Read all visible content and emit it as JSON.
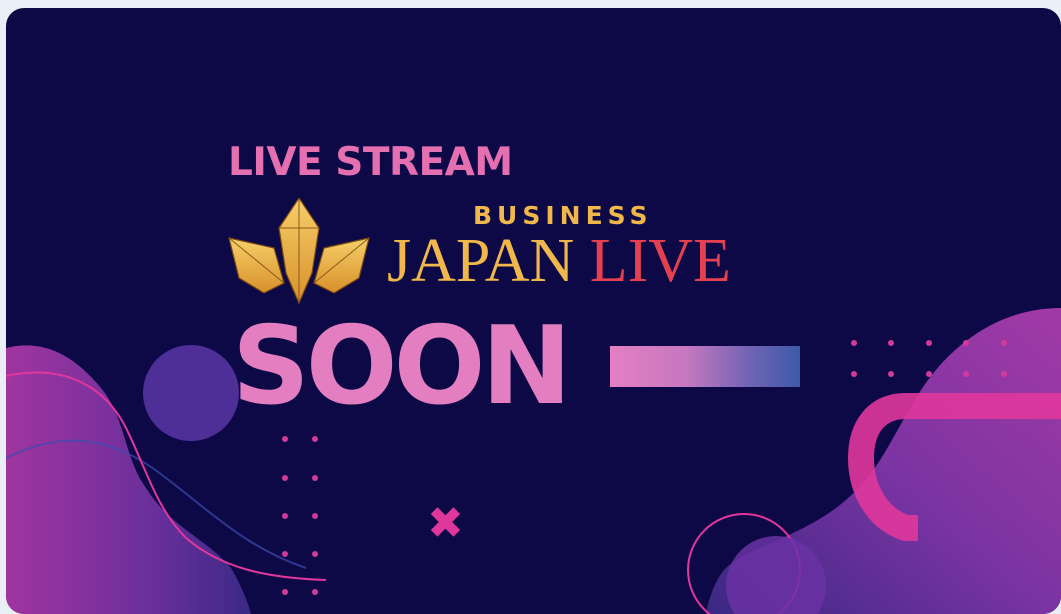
{
  "banner": {
    "live_stream": "LIVE STREAM",
    "business": "BUSINESS",
    "japan": "JAPAN",
    "live": "LIVE",
    "soon": "SOON",
    "cross_glyph": "✖"
  },
  "colors": {
    "background": "#0d0846",
    "pink_text": "#e46fb1",
    "gold": "#f0b84a",
    "red": "#e4404f",
    "magenta": "#e0379c",
    "purple_wave": "#7a2fa0"
  },
  "logo": {
    "icon": "lotus-crystal-icon"
  }
}
